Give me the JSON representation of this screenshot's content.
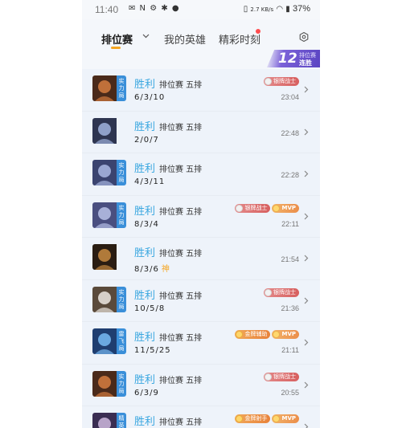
{
  "status_bar": {
    "time": "11:40",
    "left_icons": "✉ N ⚙ ✱ ●",
    "network": "2.7 KB/s",
    "battery": "37%"
  },
  "tabs": [
    {
      "label": "排位赛",
      "active": true
    },
    {
      "label": "我的英雄",
      "active": false
    },
    {
      "label": "精彩时刻",
      "active": false
    }
  ],
  "streak": {
    "number": "12",
    "top_label": "排位赛",
    "bottom_label": "连胜"
  },
  "matches": [
    {
      "result": "胜利",
      "mode": "排位赛 五排",
      "kda": "6/3/10",
      "time": "23:04",
      "side": "实力局",
      "badges": [
        {
          "type": "silver",
          "label": "银牌战士"
        }
      ],
      "shen": ""
    },
    {
      "result": "胜利",
      "mode": "排位赛 五排",
      "kda": "2/0/7",
      "time": "22:48",
      "side": "",
      "badges": [],
      "shen": ""
    },
    {
      "result": "胜利",
      "mode": "排位赛 五排",
      "kda": "4/3/11",
      "time": "22:28",
      "side": "实力局",
      "badges": [],
      "shen": ""
    },
    {
      "result": "胜利",
      "mode": "排位赛 五排",
      "kda": "8/3/4",
      "time": "22:11",
      "side": "实力局",
      "badges": [
        {
          "type": "silver",
          "label": "银牌战士"
        },
        {
          "type": "mvp",
          "label": "MVP"
        }
      ],
      "shen": ""
    },
    {
      "result": "胜利",
      "mode": "排位赛 五排",
      "kda": "8/3/6",
      "time": "21:54",
      "side": "",
      "badges": [],
      "shen": "神"
    },
    {
      "result": "胜利",
      "mode": "排位赛 五排",
      "kda": "10/5/8",
      "time": "21:36",
      "side": "实力局",
      "badges": [
        {
          "type": "silver",
          "label": "银牌战士"
        }
      ],
      "shen": ""
    },
    {
      "result": "胜利",
      "mode": "排位赛 五排",
      "kda": "11/5/25",
      "time": "21:11",
      "side": "雷飞局",
      "badges": [
        {
          "type": "gold",
          "label": "金牌辅助"
        },
        {
          "type": "mvp",
          "label": "MVP"
        }
      ],
      "shen": ""
    },
    {
      "result": "胜利",
      "mode": "排位赛 五排",
      "kda": "6/3/9",
      "time": "20:55",
      "side": "实力局",
      "badges": [
        {
          "type": "silver",
          "label": "银牌战士"
        }
      ],
      "shen": ""
    },
    {
      "result": "胜利",
      "mode": "排位赛 五排",
      "kda": "",
      "time": "",
      "side": "精英局",
      "badges": [
        {
          "type": "gold",
          "label": "金牌射手"
        },
        {
          "type": "mvp",
          "label": "MVP"
        }
      ],
      "shen": ""
    }
  ],
  "colors": {
    "accent": "#f5a623",
    "win": "#3aa7e0",
    "side_tag": "#3a8fd9"
  }
}
